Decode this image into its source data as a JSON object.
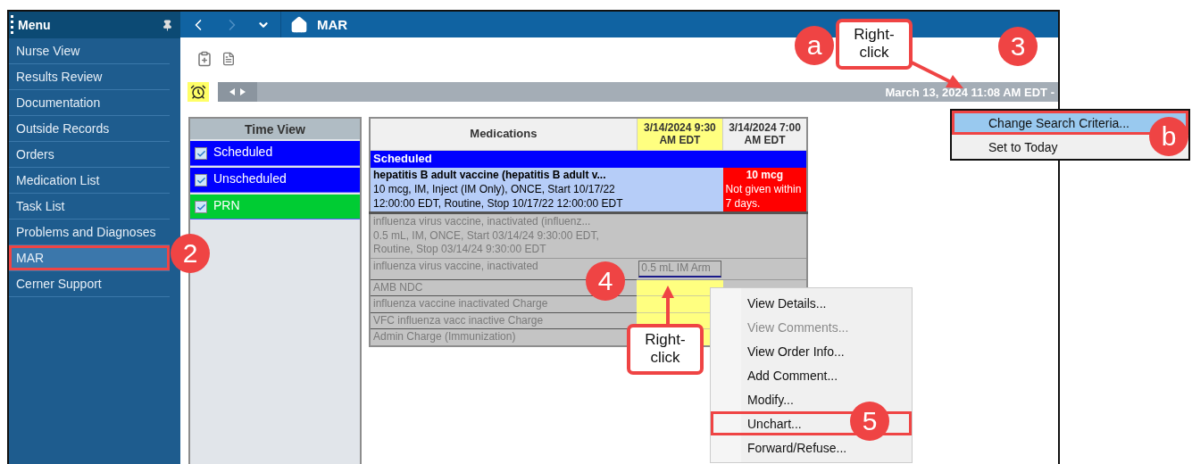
{
  "menu": {
    "title": "Menu",
    "items": [
      {
        "label": "Nurse View",
        "selected": false
      },
      {
        "label": "Results Review",
        "selected": false
      },
      {
        "label": "Documentation",
        "selected": false
      },
      {
        "label": "Outside Records",
        "selected": false
      },
      {
        "label": "Orders",
        "selected": false
      },
      {
        "label": "Medication List",
        "selected": false
      },
      {
        "label": "Task List",
        "selected": false
      },
      {
        "label": "Problems and Diagnoses",
        "selected": false
      },
      {
        "label": "MAR",
        "selected": true,
        "marked": true
      },
      {
        "label": "Cerner Support",
        "selected": false
      }
    ]
  },
  "navbar": {
    "title": "MAR"
  },
  "date_bar": {
    "text": "March 13, 2024 11:08 AM EDT -"
  },
  "time_view": {
    "title": "Time View",
    "items": [
      {
        "label": "Scheduled",
        "checked": true,
        "color": "#0000ff"
      },
      {
        "label": "Unscheduled",
        "checked": true,
        "color": "#0000ff"
      },
      {
        "label": "PRN",
        "checked": true,
        "color": "#00cc33"
      }
    ]
  },
  "medications": {
    "title": "Medications",
    "columns": [
      {
        "label": "3/14/2024 9:30 AM EDT",
        "selected": true
      },
      {
        "label": "3/14/2024 7:00 AM EDT",
        "selected": false
      }
    ],
    "rows": [
      {
        "kind": "section",
        "label": "Scheduled"
      },
      {
        "kind": "order",
        "inactive": false,
        "name": "hepatitis B adult vaccine (hepatitis B adult v...",
        "details": "10 mcg, IM, Inject (IM Only), ONCE, Start 10/17/22 12:00:00 EDT, Routine, Stop 10/17/22 12:00:00 EDT",
        "cells": [
          {
            "kind": "empty"
          },
          {
            "kind": "overdue",
            "dose": "10 mcg",
            "note": "Not given within 7 days."
          }
        ]
      },
      {
        "kind": "order",
        "inactive": true,
        "name": "influenza virus vaccine, inactivated (influenz...",
        "details": "0.5 mL, IM, ONCE, Start 03/14/24 9:30:00 EDT, Routine, Stop 03/14/24 9:30:00 EDT",
        "cells": [
          {
            "kind": "empty"
          },
          {
            "kind": "empty"
          }
        ]
      },
      {
        "kind": "task",
        "name": "influenza virus vaccine, inactivated",
        "cells": [
          {
            "kind": "charted",
            "text": "0.5 mL IM Arm"
          },
          {
            "kind": "empty"
          }
        ]
      },
      {
        "kind": "task",
        "name": "AMB NDC",
        "cells": [
          {
            "kind": "pending"
          }
        ]
      },
      {
        "kind": "task",
        "name": "influenza vaccine inactivated Charge",
        "cells": [
          {
            "kind": "pending"
          }
        ]
      },
      {
        "kind": "task",
        "name": "VFC influenza vacc inactive Charge",
        "cells": [
          {
            "kind": "pending"
          }
        ]
      },
      {
        "kind": "task",
        "name": "Admin Charge (Immunization)",
        "cells": [
          {
            "kind": "pending"
          }
        ]
      }
    ]
  },
  "date_menu": {
    "items": [
      {
        "label": "Change Search Criteria...",
        "selected": true,
        "marked": true
      },
      {
        "label": "Set to Today",
        "selected": false,
        "marked": false
      }
    ]
  },
  "cell_menu": {
    "items": [
      {
        "label": "View Details...",
        "disabled": false,
        "marked": false
      },
      {
        "label": "View Comments...",
        "disabled": true,
        "marked": false
      },
      {
        "label": "View Order Info...",
        "disabled": false,
        "marked": false
      },
      {
        "label": "Add Comment...",
        "disabled": false,
        "marked": false
      },
      {
        "label": "Modify...",
        "disabled": false,
        "marked": false
      },
      {
        "label": "Unchart...",
        "disabled": false,
        "marked": true
      },
      {
        "label": "Forward/Refuse...",
        "disabled": false,
        "marked": false
      }
    ]
  },
  "annotations": {
    "badges": [
      "a",
      "3",
      "b",
      "2",
      "4",
      "5"
    ],
    "notes": [
      "Right-click",
      "Right-click"
    ]
  }
}
